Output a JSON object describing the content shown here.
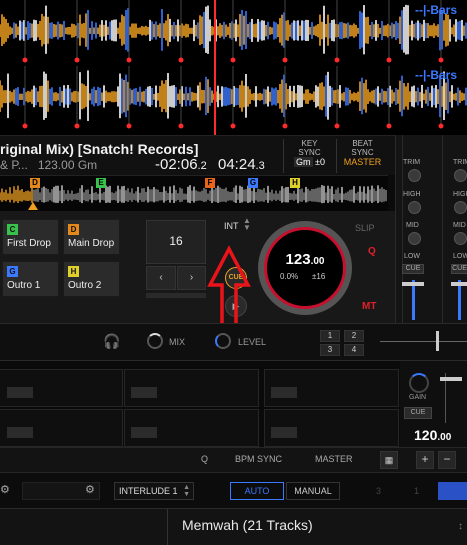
{
  "waveform": {
    "bars_label": "--|-Bars"
  },
  "deck": {
    "title": "riginal Mix) [Snatch! Records]",
    "artist": "& P...",
    "bpm_key": "123.00  Gm",
    "remaining_time": "-02:06",
    "remaining_frac": ".2",
    "elapsed_time": "04:24",
    "elapsed_frac": ".3",
    "key_sync": {
      "label_top": "KEY",
      "label_bottom": "SYNC",
      "key": "Gm",
      "offset": "±0"
    },
    "beat_sync": {
      "label_top": "BEAT",
      "label_bottom": "SYNC",
      "master": "MASTER"
    },
    "cue_tags": [
      {
        "letter": "D",
        "color": "#e58a1a"
      },
      {
        "letter": "E",
        "color": "#38c24b"
      },
      {
        "letter": "F",
        "color": "#e8641a"
      },
      {
        "letter": "G",
        "color": "#3b79ff"
      },
      {
        "letter": "H",
        "color": "#e0d12a"
      }
    ],
    "hot_cues": [
      {
        "letter": "C",
        "label": "First Drop",
        "color": "#38c24b"
      },
      {
        "letter": "D",
        "label": "Main Drop",
        "color": "#e58a1a"
      },
      {
        "letter": "G",
        "label": "Outro 1",
        "color": "#3b79ff"
      },
      {
        "letter": "H",
        "label": "Outro 2",
        "color": "#e0d12a"
      }
    ],
    "beat_jump_value": "16",
    "int_label": "INT",
    "cue_label": "CUE",
    "slip_label": "SLIP",
    "q_label": "Q",
    "mt_label": "MT",
    "jog": {
      "bpm": "123",
      "bpm_frac": ".00",
      "pitch": "0.0%",
      "range": "±16"
    }
  },
  "mixer": {
    "trim": "TRIM",
    "high": "HIGH",
    "mid": "MID",
    "low": "LOW",
    "cue": "CUE"
  },
  "midbar": {
    "mix": "MIX",
    "level": "LEVEL",
    "deck_buttons": [
      "1",
      "2",
      "3",
      "4"
    ]
  },
  "sampler": {
    "gain": "GAIN",
    "cue": "CUE",
    "bpm": "120",
    "bpm_frac": ".00"
  },
  "controls": {
    "q": "Q",
    "bpm_sync": "BPM SYNC",
    "master": "MASTER",
    "plus": "+",
    "minus": "−"
  },
  "loopbar": {
    "preset": "INTERLUDE 1",
    "auto": "AUTO",
    "manual": "MANUAL",
    "nums": [
      "3",
      "1"
    ]
  },
  "browser": {
    "playlist": "Memwah (21 Tracks)"
  },
  "colors": {
    "accent_blue": "#3b79ff",
    "red": "#e0202a",
    "orange": "#f0a020"
  }
}
